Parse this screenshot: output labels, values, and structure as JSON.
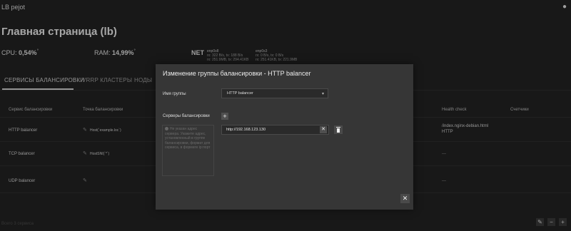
{
  "app": {
    "title": "LB pejot",
    "user_icon": "person-icon"
  },
  "page": {
    "title": "Главная страница (lb)"
  },
  "stats": {
    "cpu_label": "CPU:",
    "cpu_value": "0,54%",
    "ram_label": "RAM:",
    "ram_value": "14,99%",
    "net_label": "NET",
    "interfaces": [
      {
        "name": "enp0s8",
        "line1": "rx: 322 B/s, tx: 188 B/s",
        "line2": "rx: 251.9MB, tx: 294.41KB"
      },
      {
        "name": "enp0s3",
        "line1": "rx: 0 B/s, tx: 0 B/s",
        "line2": "rx: 251.41KB, tx: 221.9MB"
      }
    ]
  },
  "tabs": [
    {
      "label": "СЕРВИСЫ БАЛАНСИРОВКИ",
      "active": true
    },
    {
      "label": "VRRP КЛАСТЕРЫ",
      "active": false
    },
    {
      "label": "НОДЫ",
      "active": false
    }
  ],
  "table": {
    "headers": [
      "Сервис балансировки",
      "Точка балансировки",
      "Health check",
      "Счетчики"
    ],
    "rows": [
      {
        "service": "HTTP balancer",
        "point": "Host(`example.loc`)",
        "health_line1": "/index.nginx-debian.html",
        "health_line2": "HTTP"
      },
      {
        "service": "TCP balancer",
        "point": "HostSNI(`*`)",
        "health_line1": "—",
        "health_line2": ""
      },
      {
        "service": "UDP balancer",
        "point": "",
        "health_line1": "—",
        "health_line2": ""
      }
    ]
  },
  "footer": {
    "text": "Всего 3 сервиса"
  },
  "modal": {
    "title": "Изменение группы балансировки - HTTP balancer",
    "group_label": "Имя группы",
    "group_value": "HTTP balancer",
    "servers_label": "Серверы балансировки",
    "add_label": "+",
    "hint_text": "Не указан адрес сервера. Укажите адрес, установленный в группе балансировки, формат для сервиса, в формате ip:порт",
    "server_value": "http://192.168.123.130",
    "clear_label": "✕",
    "close_label": "✕"
  }
}
